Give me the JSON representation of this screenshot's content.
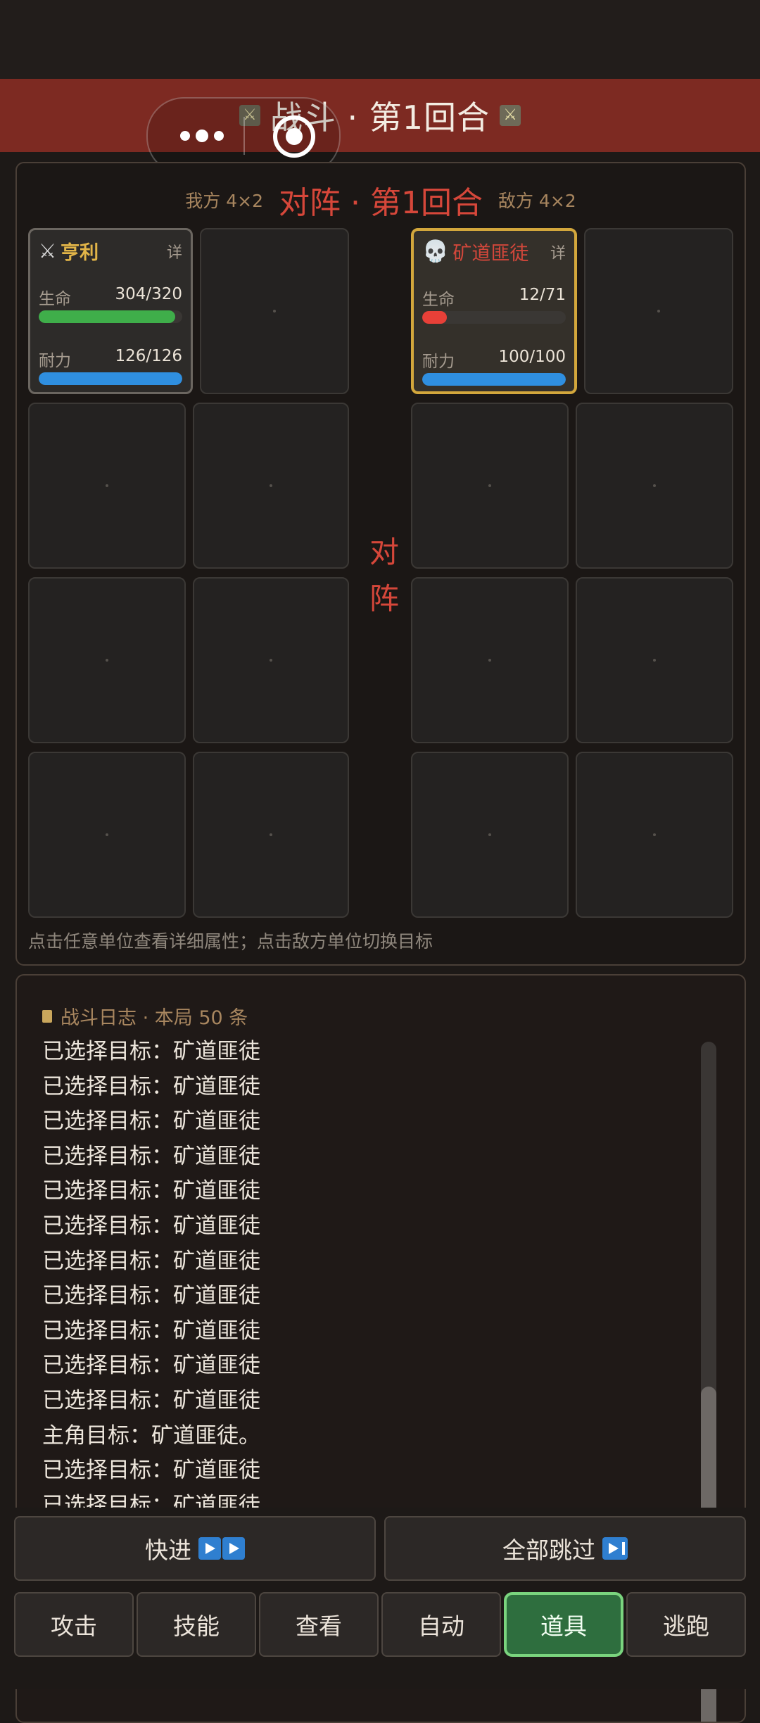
{
  "header": {
    "title": "战斗 · 第1回合",
    "icon_left": "crossed-swords-icon",
    "icon_right": "crossed-swords-icon"
  },
  "battlefield": {
    "ally_label": "我方 4×2",
    "title": "对阵 · 第1回合",
    "enemy_label": "敌方 4×2",
    "vs_top": "对",
    "vs_bottom": "阵",
    "hint": "点击任意单位查看详细属性；点击敌方单位切换目标",
    "ally_unit": {
      "icon": "crossed-swords-icon",
      "name": "亨利",
      "detail": "详",
      "hp_label": "生命",
      "hp_value": "304/320",
      "hp_ratio": 0.95,
      "stamina_label": "耐力",
      "stamina_value": "126/126",
      "stamina_ratio": 1.0
    },
    "enemy_unit": {
      "icon": "skull-icon",
      "name": "矿道匪徒",
      "detail": "详",
      "hp_label": "生命",
      "hp_value": "12/71",
      "hp_ratio": 0.17,
      "stamina_label": "耐力",
      "stamina_value": "100/100",
      "stamina_ratio": 1.0
    }
  },
  "log": {
    "title": "战斗日志 · 本局 50 条",
    "lines": [
      "已选择目标：矿道匪徒",
      "已选择目标：矿道匪徒",
      "已选择目标：矿道匪徒",
      "已选择目标：矿道匪徒",
      "已选择目标：矿道匪徒",
      "已选择目标：矿道匪徒",
      "已选择目标：矿道匪徒",
      "已选择目标：矿道匪徒",
      "已选择目标：矿道匪徒",
      "已选择目标：矿道匪徒",
      "已选择目标：矿道匪徒",
      "主角目标：矿道匪徒。",
      "已选择目标：矿道匪徒",
      "已选择目标：矿道匪徒"
    ]
  },
  "controls": {
    "fast_forward": "快进",
    "skip_all": "全部跳过",
    "actions": [
      "攻击",
      "技能",
      "查看",
      "自动",
      "道具",
      "逃跑"
    ],
    "active_action": "道具"
  },
  "colors": {
    "hp_ally": "#3fae4a",
    "hp_enemy": "#e84038",
    "stamina": "#2f8fe0",
    "accent_red": "#d6473a",
    "enemy_border": "#d3a73c"
  }
}
